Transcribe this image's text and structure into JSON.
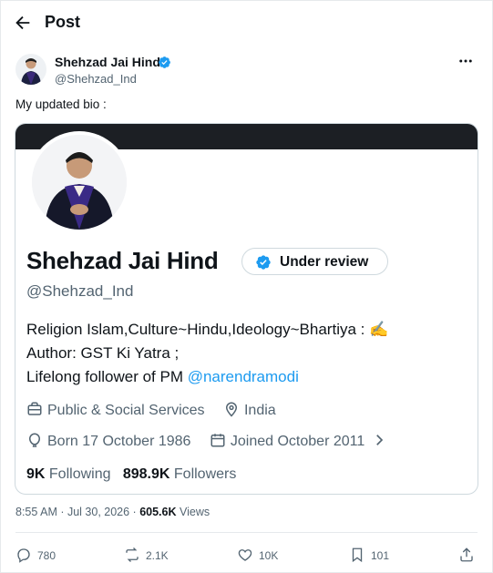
{
  "header": {
    "title": "Post"
  },
  "author": {
    "name": "Shehzad Jai Hind",
    "handle": "@Shehzad_Ind"
  },
  "tweet": {
    "text": "My updated bio :"
  },
  "card": {
    "name": "Shehzad Jai Hind",
    "review_label": "Under review",
    "handle": "@Shehzad_Ind",
    "bio_line1": "Religion Islam,Culture~Hindu,Ideology~Bhartiya : ✍️",
    "bio_line2": "Author: GST Ki Yatra ;",
    "bio_line3_prefix": "Lifelong follower of PM ",
    "bio_mention": "@narendramodi",
    "category": "Public & Social Services",
    "location": "India",
    "born": "Born 17 October 1986",
    "joined": "Joined October 2011",
    "following_count": "9K",
    "following_label": "Following",
    "followers_count": "898.9K",
    "followers_label": "Followers"
  },
  "meta": {
    "time": "8:55 AM · Jul 30, 2026 · ",
    "views_count": "605.6K",
    "views_label": " Views"
  },
  "actions": {
    "replies": "780",
    "reposts": "2.1K",
    "likes": "10K",
    "bookmarks": "101"
  },
  "colors": {
    "accent": "#1d9bf0",
    "text": "#0f1419",
    "muted": "#536471",
    "border": "#cfd9de"
  },
  "icons": [
    "back-arrow-icon",
    "verified-badge-icon",
    "more-icon",
    "briefcase-icon",
    "location-pin-icon",
    "balloon-icon",
    "calendar-icon",
    "chevron-right-icon",
    "reply-icon",
    "repost-icon",
    "like-icon",
    "bookmark-icon",
    "share-icon"
  ]
}
